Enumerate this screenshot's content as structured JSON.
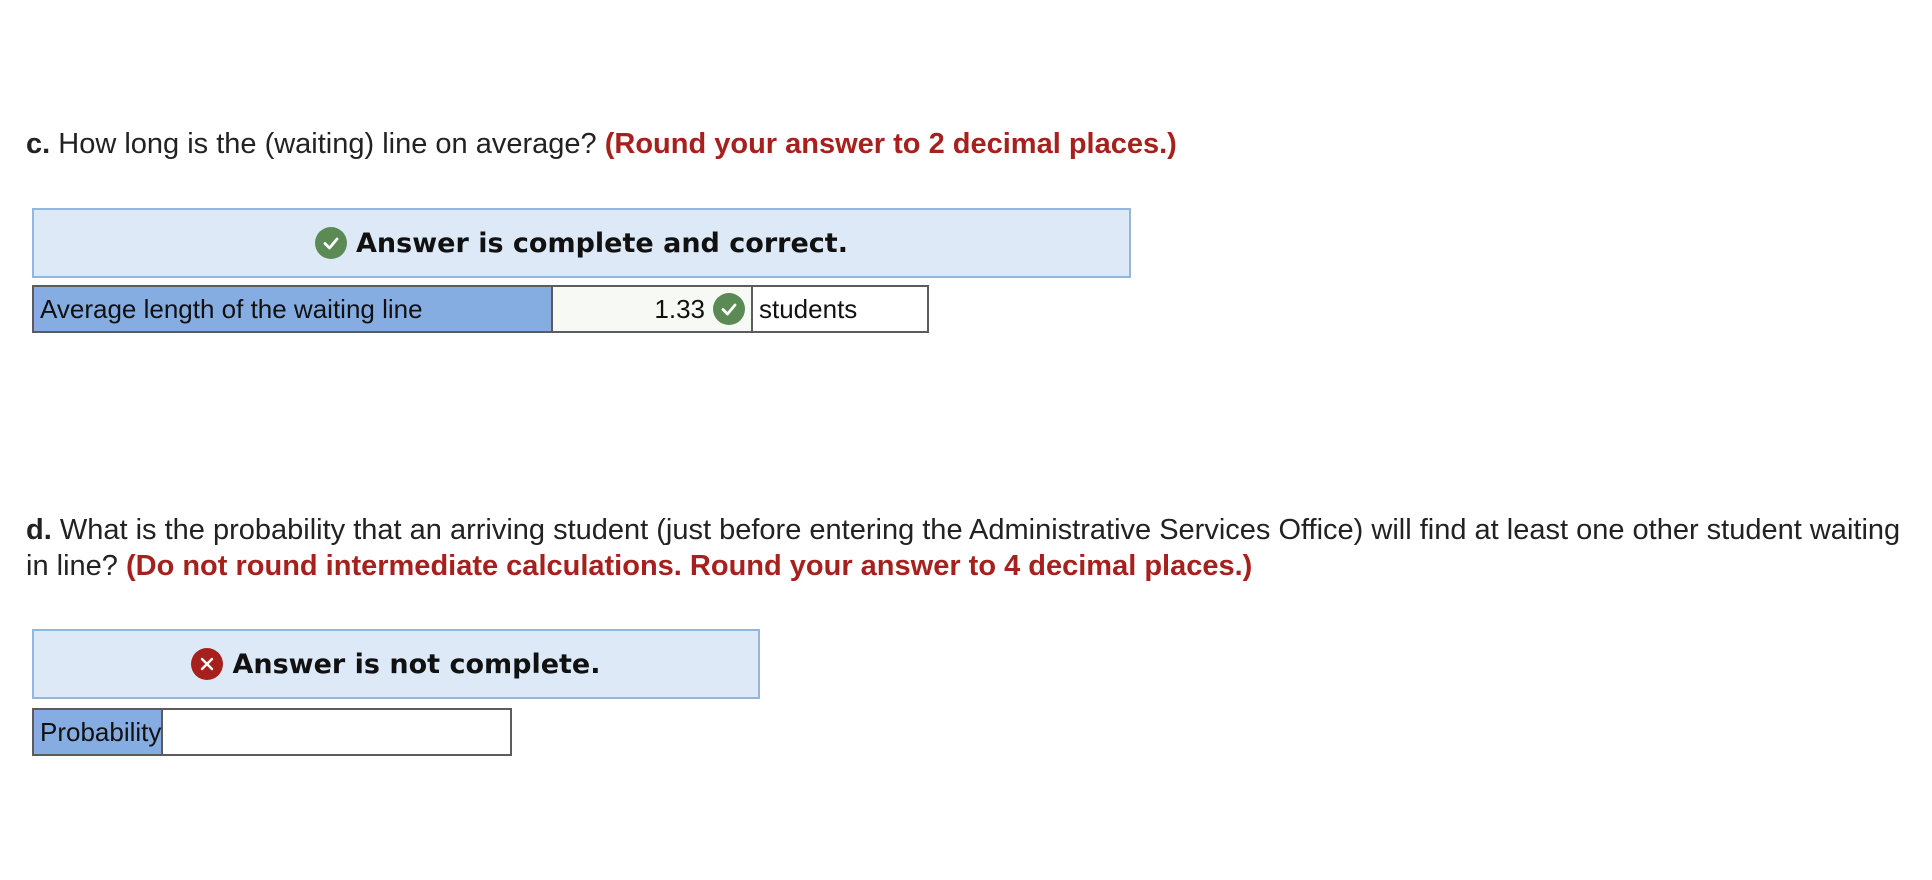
{
  "part_c": {
    "label": "c.",
    "question": "How long is the (waiting) line on average?",
    "instruction": "(Round your answer to 2 decimal places.)",
    "status": {
      "icon": "check-circle-icon",
      "message": "Answer is complete and correct.",
      "color": "#5b8a55"
    },
    "row": {
      "label": "Average length of the waiting line",
      "value": "1.33",
      "value_status_icon": "check-circle-icon",
      "unit": "students"
    }
  },
  "part_d": {
    "label": "d.",
    "question": "What is the probability that an arriving student (just before entering the Administrative Services Office) will find at least one other student waiting in line?",
    "instruction": "(Do not round intermediate calculations. Round your answer to 4 decimal places.)",
    "status": {
      "icon": "x-circle-icon",
      "message": "Answer is not complete.",
      "color": "#a6211d"
    },
    "row": {
      "label": "Probability",
      "value": ""
    }
  },
  "colors": {
    "instruction_red": "#a6211d",
    "banner_bg": "#dde9f7",
    "banner_border": "#93b6df",
    "label_cell_bg": "#86ade2"
  }
}
